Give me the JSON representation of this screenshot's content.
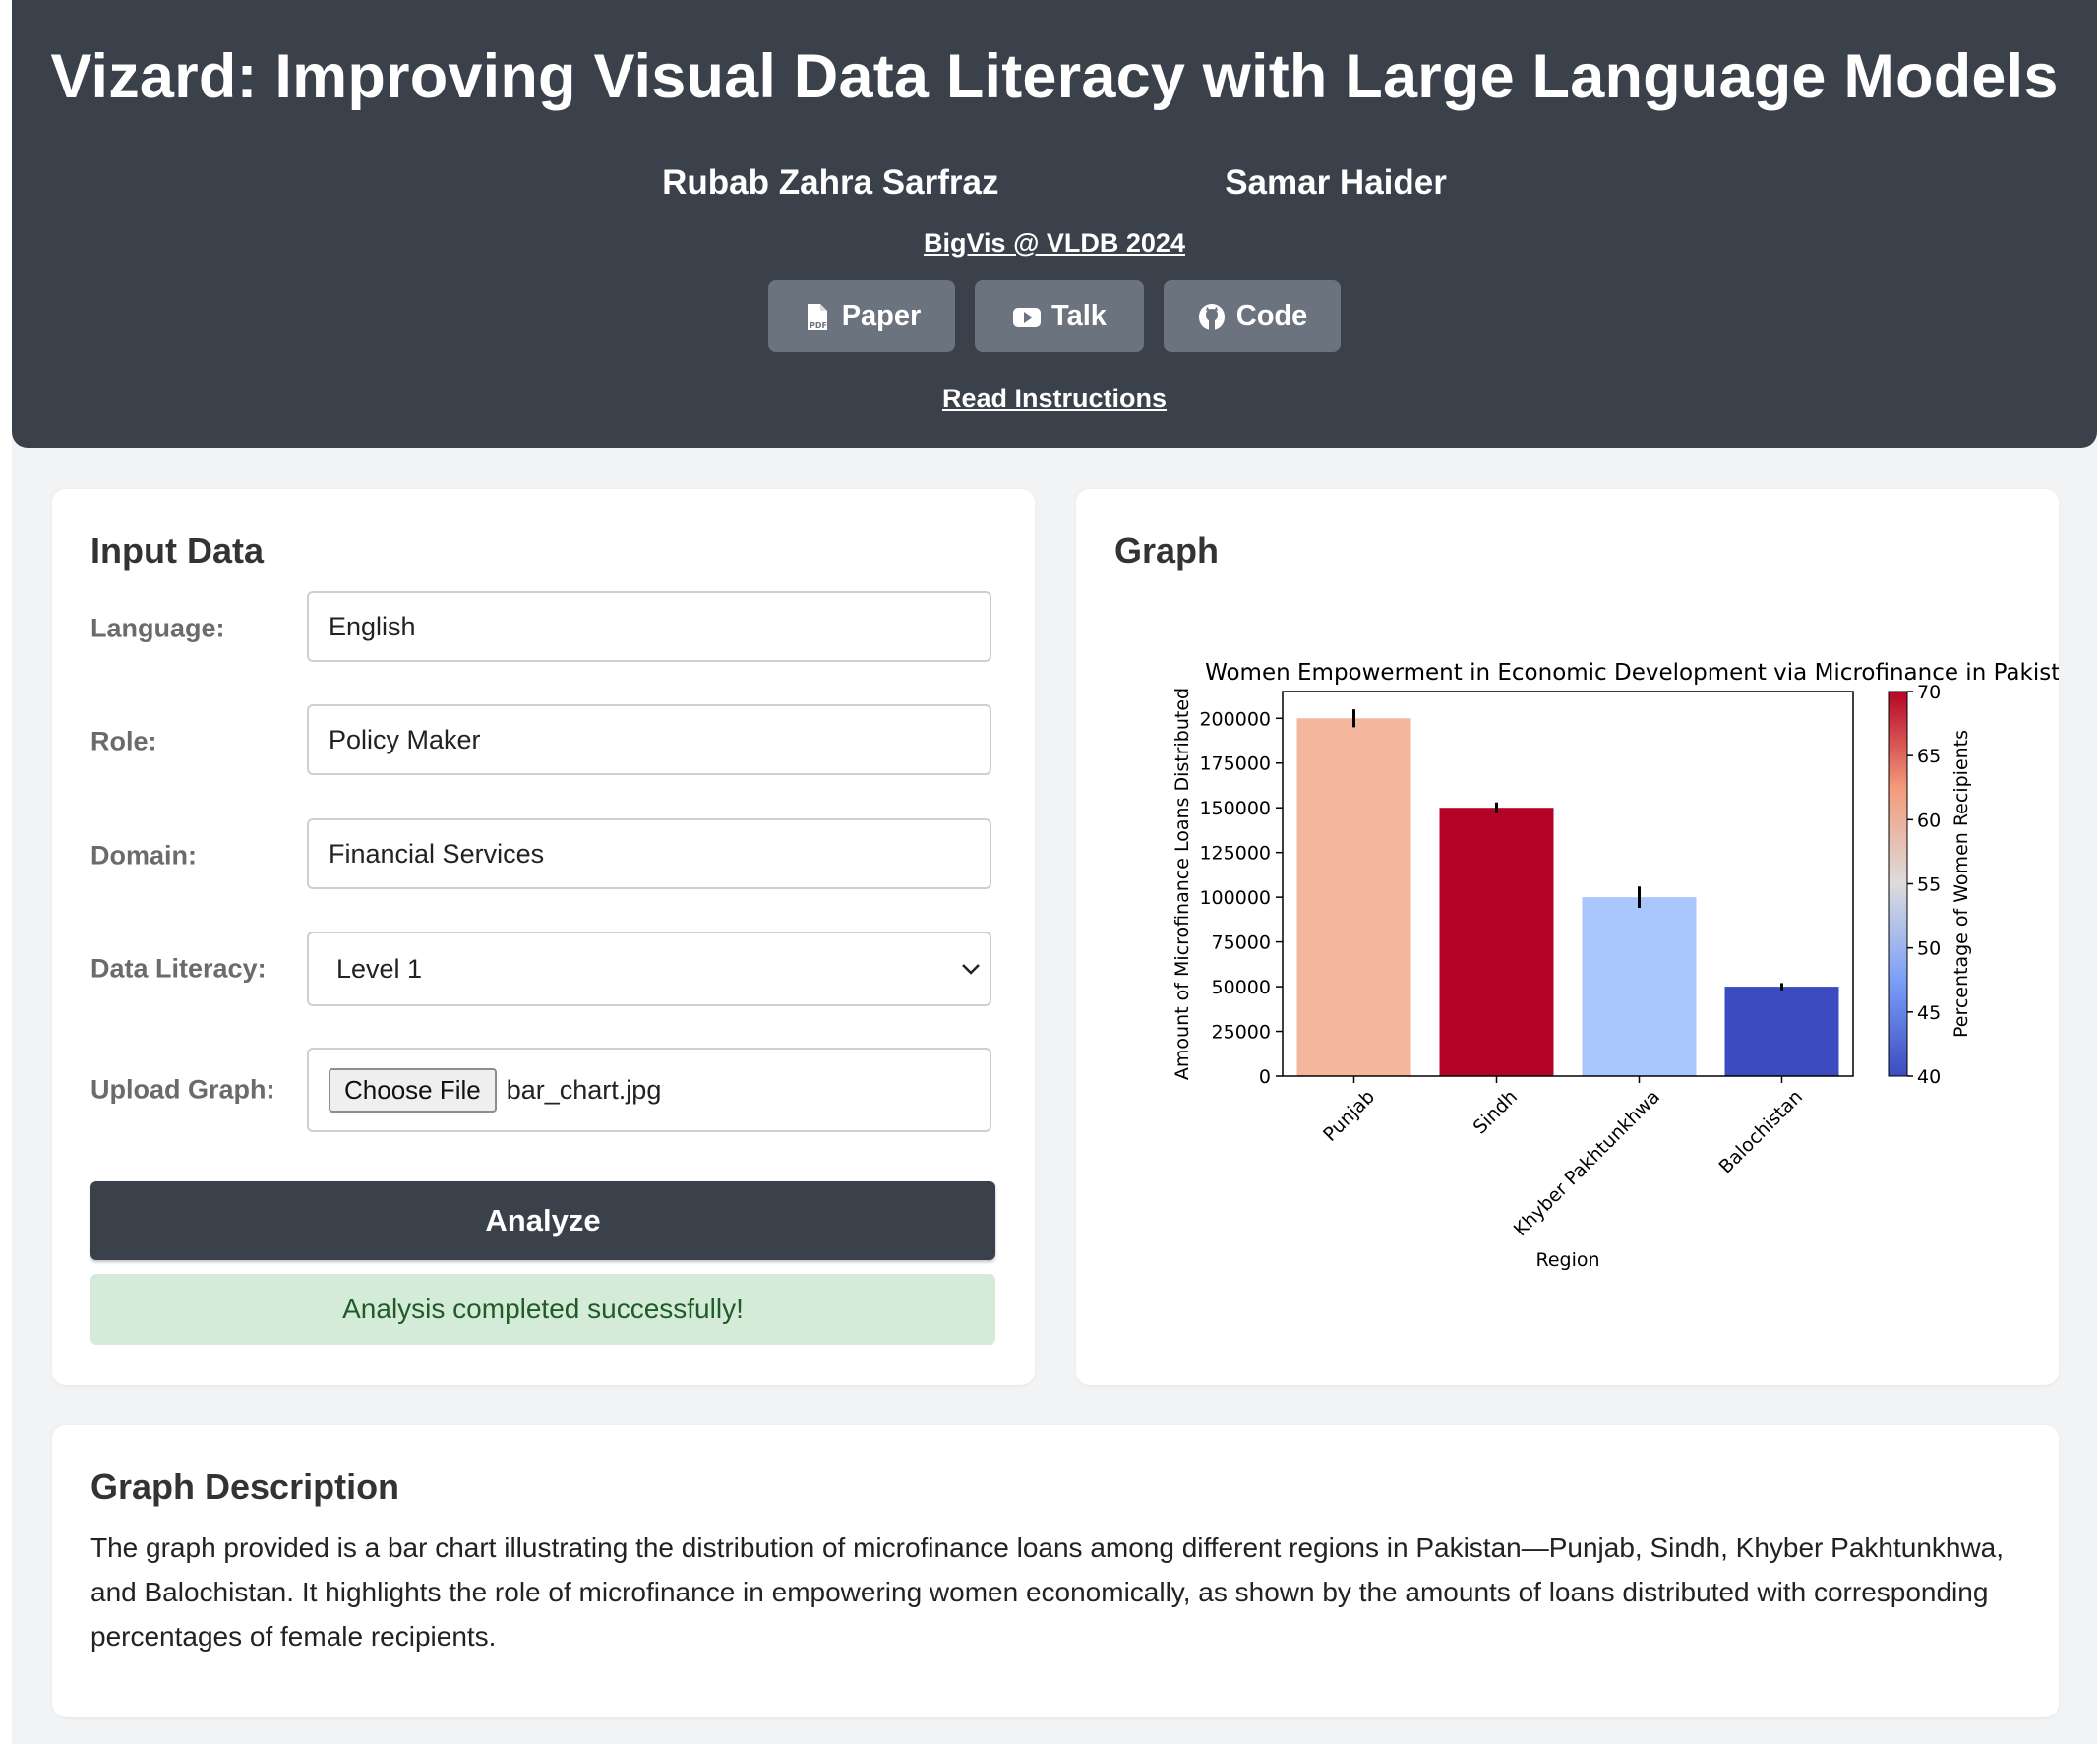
{
  "header": {
    "title": "Vizard: Improving Visual Data Literacy with Large Language Models",
    "authors": [
      "Rubab Zahra Sarfraz",
      "Samar Haider"
    ],
    "venue": "BigVis @ VLDB 2024",
    "buttons": [
      {
        "label": "Paper",
        "icon": "pdf-icon"
      },
      {
        "label": "Talk",
        "icon": "youtube-icon"
      },
      {
        "label": "Code",
        "icon": "github-icon"
      }
    ],
    "instructions_link": "Read Instructions"
  },
  "input_panel": {
    "title": "Input Data",
    "language": {
      "label": "Language:",
      "value": "English"
    },
    "role": {
      "label": "Role:",
      "value": "Policy Maker"
    },
    "domain": {
      "label": "Domain:",
      "value": "Financial Services"
    },
    "data_literacy": {
      "label": "Data Literacy:",
      "value": "Level 1"
    },
    "upload": {
      "label": "Upload Graph:",
      "button": "Choose File",
      "filename": "bar_chart.jpg"
    },
    "analyze_label": "Analyze",
    "status": "Analysis completed successfully!"
  },
  "graph_panel": {
    "title": "Graph"
  },
  "description": {
    "title": "Graph Description",
    "text": "The graph provided is a bar chart illustrating the distribution of microfinance loans among different regions in Pakistan—Punjab, Sindh, Khyber Pakhtunkhwa, and Balochistan. It highlights the role of microfinance in empowering women economically, as shown by the amounts of loans distributed with corresponding percentages of female recipients."
  },
  "colors": {
    "header_bg": "#3a414a",
    "button_bg": "#6b737f",
    "success_bg": "#d4ebd7",
    "success_text": "#1f5c2a"
  },
  "chart_data": {
    "type": "bar",
    "title": "Women Empowerment in Economic Development via Microfinance in Pakistan",
    "xlabel": "Region",
    "ylabel": "Amount of Microfinance Loans Distributed",
    "categories": [
      "Punjab",
      "Sindh",
      "Khyber Pakhtunkhwa",
      "Balochistan"
    ],
    "values": [
      200000,
      150000,
      100000,
      50000
    ],
    "errors": [
      5000,
      3000,
      6000,
      2000
    ],
    "ylim": [
      0,
      215000
    ],
    "yticks": [
      0,
      25000,
      50000,
      75000,
      100000,
      125000,
      150000,
      175000,
      200000
    ],
    "color_values": [
      60,
      70,
      50,
      40
    ],
    "colorbar": {
      "label": "Percentage of Women Recipients",
      "range": [
        40,
        70
      ],
      "ticks": [
        40,
        45,
        50,
        55,
        60,
        65,
        70
      ],
      "colormap": "coolwarm"
    },
    "bar_colors": [
      "#f4b69c",
      "#b40426",
      "#aac7fd",
      "#3b4cc0"
    ],
    "grid": false,
    "legend": "none"
  }
}
